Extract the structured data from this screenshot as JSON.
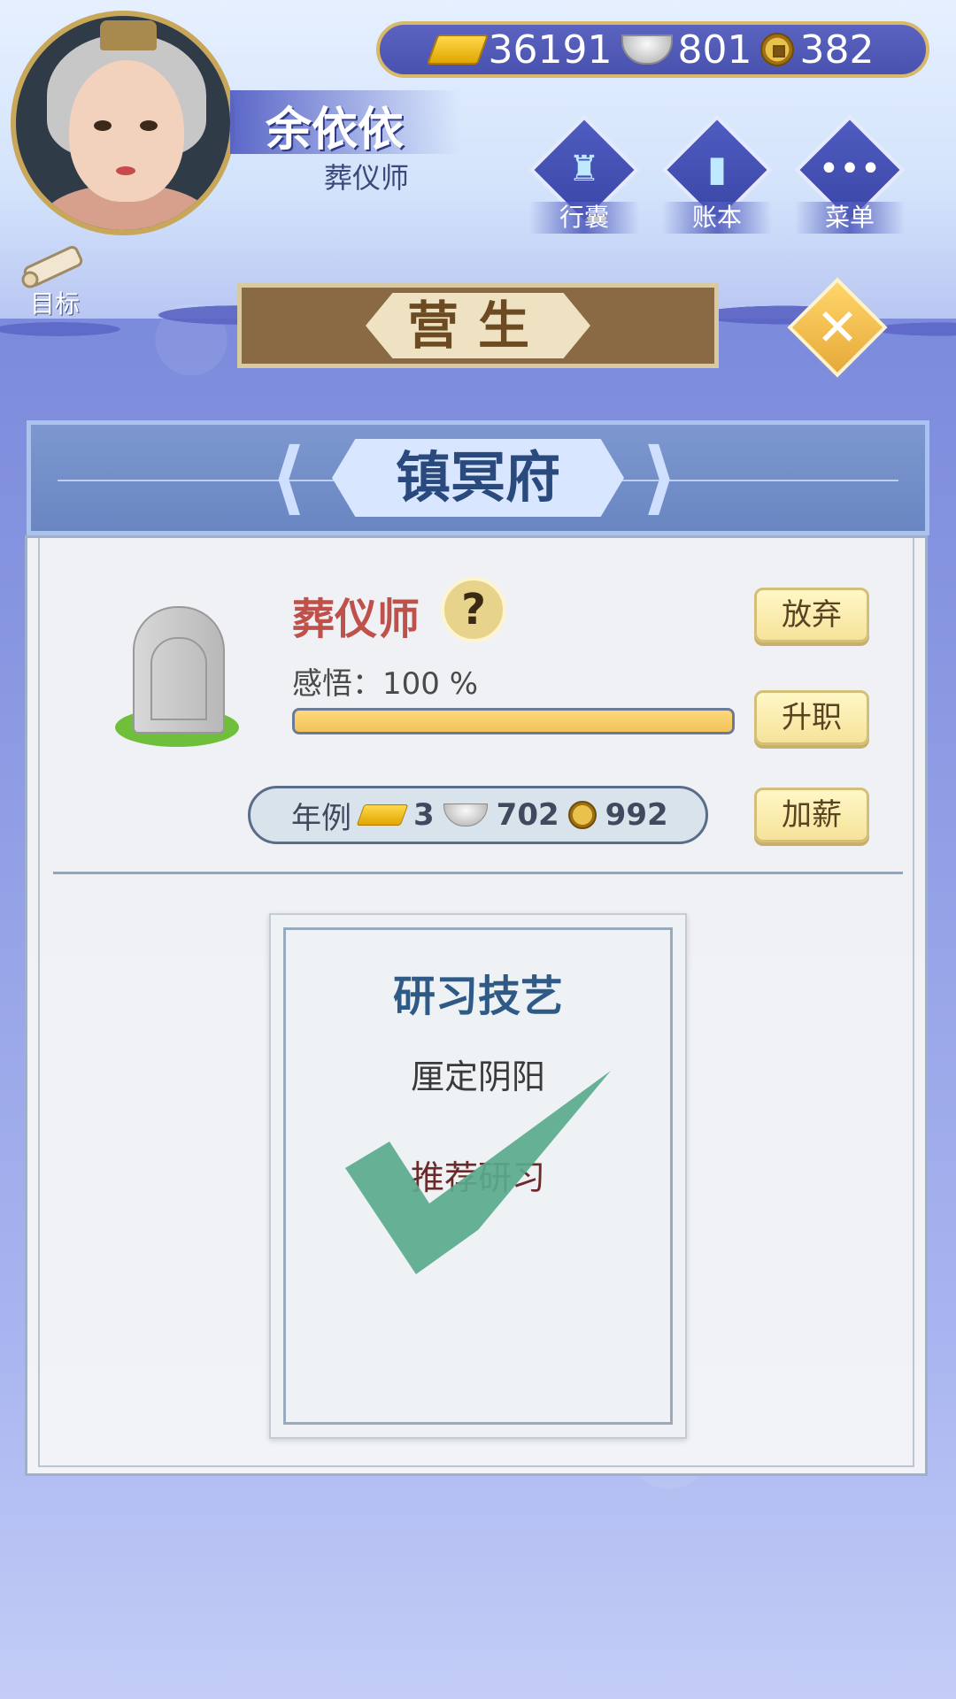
{
  "currency": {
    "gold": "36191",
    "silver": "801",
    "coin": "382"
  },
  "player": {
    "name": "余依依",
    "title": "葬仪师"
  },
  "menu": {
    "bag": "行囊",
    "ledger": "账本",
    "menu": "菜单"
  },
  "goal": {
    "label": "目标"
  },
  "screen_title": "营生",
  "panel": {
    "title": "镇冥府",
    "job_name": "葬仪师",
    "help_glyph": "?",
    "insight_text": "感悟：100 %",
    "insight_progress": 1.0,
    "buttons": {
      "abandon": "放弃",
      "promote": "升职",
      "raise": "加薪"
    },
    "salary": {
      "label": "年例",
      "gold": "3",
      "silver": "702",
      "coin": "992"
    }
  },
  "skill_card": {
    "title": "研习技艺",
    "skill": "厘定阴阳",
    "recommend": "推荐研习"
  },
  "colors": {
    "accent_gold": "#d8b86a",
    "panel_blue": "#6a86c2",
    "check_green": "#5aaa8c"
  }
}
